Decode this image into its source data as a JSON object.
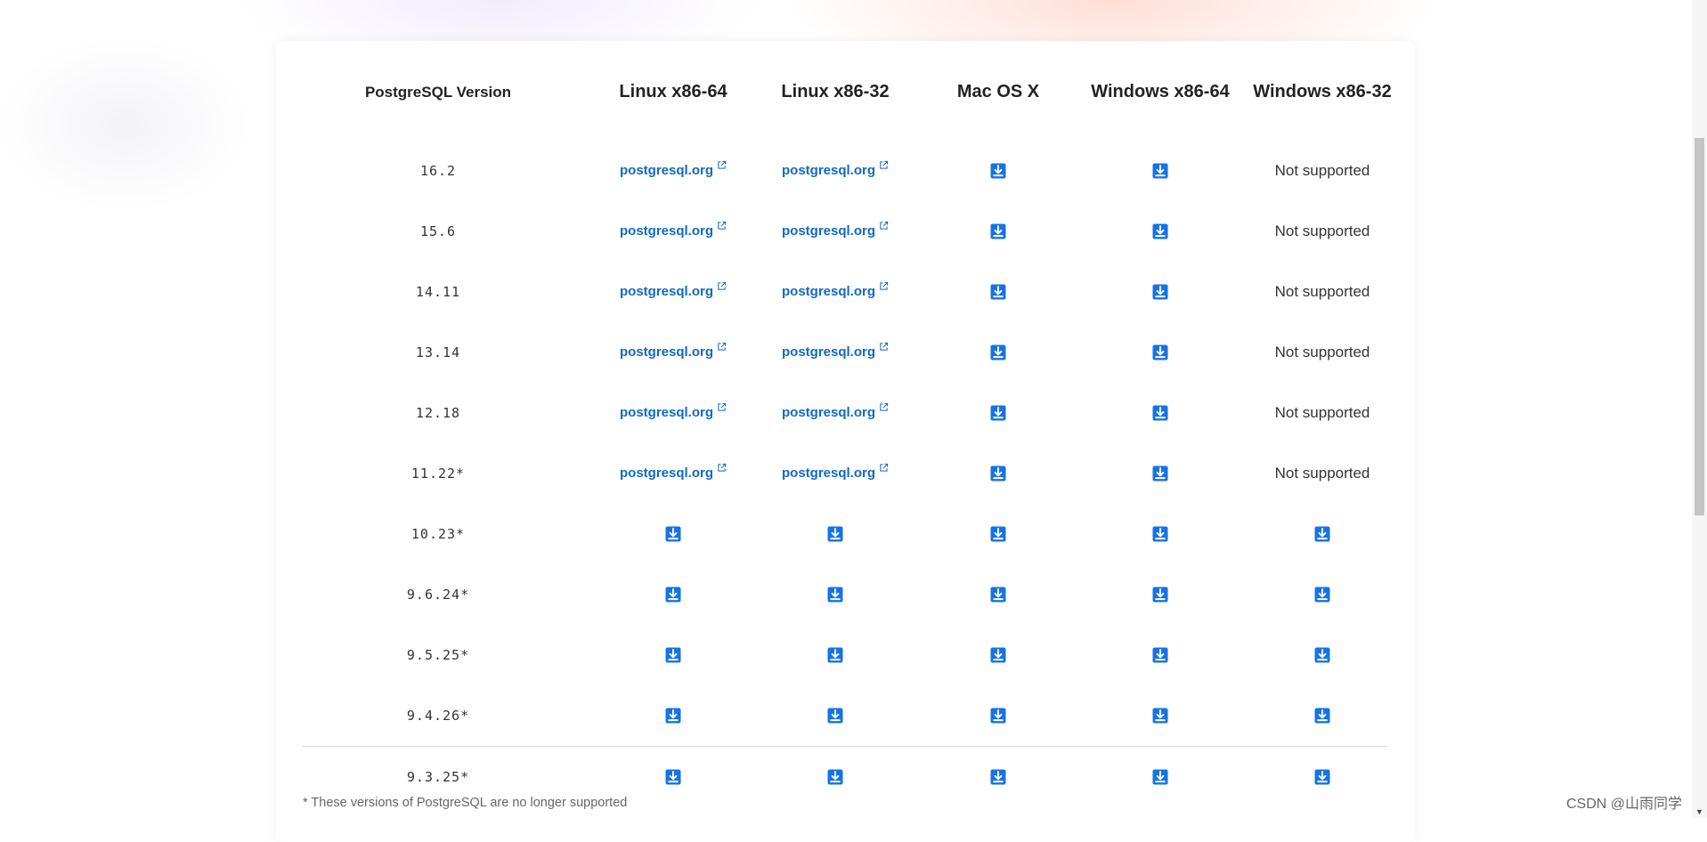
{
  "colors": {
    "link": "#1169c7",
    "download_icon": "#1473e6",
    "text": "#333333"
  },
  "table": {
    "headers": {
      "version": "PostgreSQL Version",
      "linux64": "Linux x86-64",
      "linux32": "Linux x86-32",
      "mac": "Mac OS X",
      "win64": "Windows x86-64",
      "win32": "Windows x86-32"
    },
    "link_label": "postgresql.org",
    "not_supported_label": "Not supported",
    "rows": [
      {
        "version": "16.2",
        "linux64": "link",
        "linux32": "link",
        "mac": "download",
        "win64": "download",
        "win32": "not_supported"
      },
      {
        "version": "15.6",
        "linux64": "link",
        "linux32": "link",
        "mac": "download",
        "win64": "download",
        "win32": "not_supported"
      },
      {
        "version": "14.11",
        "linux64": "link",
        "linux32": "link",
        "mac": "download",
        "win64": "download",
        "win32": "not_supported"
      },
      {
        "version": "13.14",
        "linux64": "link",
        "linux32": "link",
        "mac": "download",
        "win64": "download",
        "win32": "not_supported"
      },
      {
        "version": "12.18",
        "linux64": "link",
        "linux32": "link",
        "mac": "download",
        "win64": "download",
        "win32": "not_supported"
      },
      {
        "version": "11.22*",
        "linux64": "link",
        "linux32": "link",
        "mac": "download",
        "win64": "download",
        "win32": "not_supported"
      },
      {
        "version": "10.23*",
        "linux64": "download",
        "linux32": "download",
        "mac": "download",
        "win64": "download",
        "win32": "download"
      },
      {
        "version": "9.6.24*",
        "linux64": "download",
        "linux32": "download",
        "mac": "download",
        "win64": "download",
        "win32": "download"
      },
      {
        "version": "9.5.25*",
        "linux64": "download",
        "linux32": "download",
        "mac": "download",
        "win64": "download",
        "win32": "download"
      },
      {
        "version": "9.4.26*",
        "linux64": "download",
        "linux32": "download",
        "mac": "download",
        "win64": "download",
        "win32": "download"
      },
      {
        "version": "9.3.25*",
        "linux64": "download",
        "linux32": "download",
        "mac": "download",
        "win64": "download",
        "win32": "download"
      }
    ]
  },
  "footnote": "* These versions of PostgreSQL are no longer supported",
  "watermark": "CSDN @山雨同学"
}
